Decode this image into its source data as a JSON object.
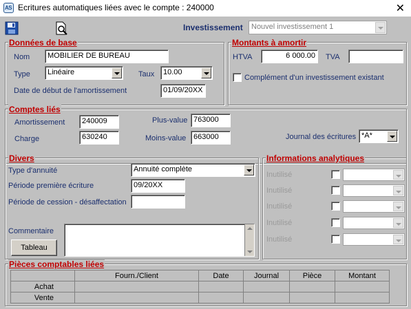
{
  "window": {
    "title": "Ecritures automatiques liées avec le compte : 240000"
  },
  "toolbar": {
    "investissement_label": "Investissement",
    "investissement_value": "Nouvel investissement 1"
  },
  "donnees_de_base": {
    "title": "Données de base",
    "nom_label": "Nom",
    "nom_value": "MOBILIER DE BUREAU",
    "type_label": "Type",
    "type_value": "Linéaire",
    "taux_label": "Taux",
    "taux_value": "10.00",
    "date_label": "Date de début de l'amortissement",
    "date_value": "01/09/20XX"
  },
  "montants": {
    "title": "Montants à amortir",
    "htva_label": "HTVA",
    "htva_value": "6 000.00",
    "tva_label": "TVA",
    "tva_value": "",
    "complement_label": "Complément d'un investissement existant"
  },
  "comptes_lies": {
    "title": "Comptes liés",
    "amortissement_label": "Amortissement",
    "amortissement_value": "240009",
    "charge_label": "Charge",
    "charge_value": "630240",
    "plus_value_label": "Plus-value",
    "plus_value_value": "763000",
    "moins_value_label": "Moins-value",
    "moins_value_value": "663000",
    "journal_label": "Journal des écritures",
    "journal_value": "*A*"
  },
  "divers": {
    "title": "Divers",
    "type_annuite_label": "Type d'annuité",
    "type_annuite_value": "Annuité complète",
    "periode_premiere_label": "Période première écriture",
    "periode_premiere_value": "09/20XX",
    "periode_cession_label": "Période de cession - désaffectation",
    "periode_cession_value": "",
    "commentaire_label": "Commentaire",
    "tableau_button": "Tableau"
  },
  "analytiques": {
    "title": "Informations analytiques",
    "rows": [
      {
        "label": "Inutilisé"
      },
      {
        "label": "Inutilisé"
      },
      {
        "label": "Inutilisé"
      },
      {
        "label": "Inutilisé"
      },
      {
        "label": "Inutilisé"
      }
    ]
  },
  "pieces": {
    "title": "Pièces comptables liées",
    "columns": [
      "",
      "Fourn./Client",
      "Date",
      "Journal",
      "Pièce",
      "Montant"
    ],
    "rows": [
      {
        "label": "Achat"
      },
      {
        "label": "Vente"
      }
    ]
  }
}
